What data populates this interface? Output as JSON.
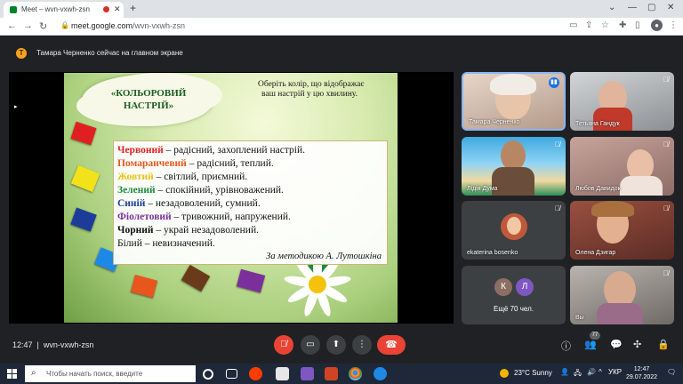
{
  "browser": {
    "tab_title": "Meet – wvn-vxwh-zsn",
    "new_tab_label": "+",
    "url_host": "meet.google.com",
    "url_path": "/wvn-vxwh-zsn"
  },
  "banner": {
    "avatar_letter": "Т",
    "text": "Тамара Черненко сейчас на главном экране"
  },
  "slide": {
    "title_line1": "«КОЛЬОРОВИЙ",
    "title_line2": "НАСТРІЙ»",
    "instruction_line1": "Оберіть колір, що відображає",
    "instruction_line2": "ваш настрій у цю хвилину.",
    "moods": [
      {
        "color_name": "Червоний",
        "desc": " – радісний, захоплений настрій.",
        "color": "#e02020"
      },
      {
        "color_name": "Помаранчевий",
        "desc": " – радісний, теплий.",
        "color": "#e8561e"
      },
      {
        "color_name": "Жовтий",
        "desc": " – світлий, приємний.",
        "color": "#e8c21a"
      },
      {
        "color_name": "Зелений",
        "desc": " – спокійний, урівноважений.",
        "color": "#1e8a3c"
      },
      {
        "color_name": "Синій",
        "desc": " – незадоволений, сумний.",
        "color": "#1d3c9a"
      },
      {
        "color_name": "Фіолетовий",
        "desc": " – тривожний, напружений.",
        "color": "#7b2f9b"
      },
      {
        "color_name": "Чорний",
        "desc": " – украй незадоволений.",
        "color": "#111111"
      },
      {
        "color_name": "Білий",
        "desc": " – невизначений.",
        "color": "#111111"
      }
    ],
    "author": "За методикою А. Лутошкіна"
  },
  "participants": [
    {
      "name": "Тамара Черненко",
      "speaking": true
    },
    {
      "name": "Тетьяна Гандук",
      "muted": true
    },
    {
      "name": "Лідія Дума",
      "muted": true
    },
    {
      "name": "Любов Давидок",
      "muted": true
    },
    {
      "name": "ekaterina bosenko",
      "muted": true
    },
    {
      "name": "Олена Дзигар",
      "muted": true
    },
    {
      "name": "Вы",
      "muted": true
    }
  ],
  "more_tile": {
    "avatar1": "К",
    "avatar2": "Л",
    "label": "Ещё 70 чел."
  },
  "bottom": {
    "time": "12:47",
    "meeting_code": "wvn-vxwh-zsn",
    "participants_count": "77"
  },
  "taskbar": {
    "search_placeholder": "Чтобы начать поиск, введите",
    "weather": "23°C  Sunny",
    "lang": "УКР",
    "time": "12:47",
    "date": "29.07.2022"
  },
  "colors": {
    "meet_bg": "#202124",
    "tile_bg": "#3c4043",
    "hangup_red": "#ea4335",
    "speaking_blue": "#1a73e8"
  }
}
